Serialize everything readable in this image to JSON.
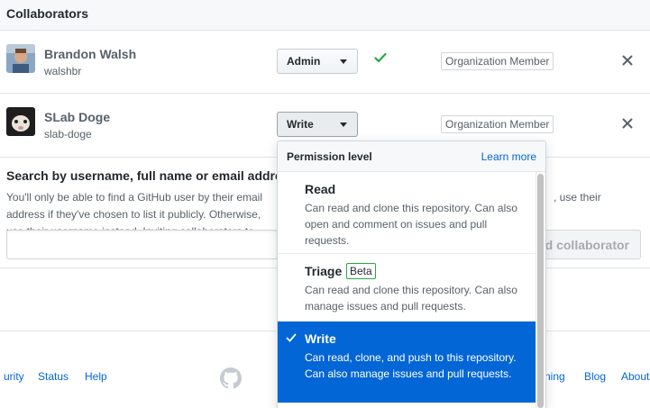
{
  "header": {
    "title": "Collaborators"
  },
  "collaborators": [
    {
      "name": "Brandon Walsh",
      "login": "walshbr",
      "permission": "Admin",
      "badge": "Organization Member"
    },
    {
      "name": "SLab Doge",
      "login": "slab-doge",
      "permission": "Write",
      "badge": "Organization Member"
    }
  ],
  "search": {
    "heading": "Search by username, full name or email address",
    "note_left": "You'll only be able to find a GitHub user by their email address if they've chosen to list it publicly. Otherwise, use their username instead. Inviting collaborators to public repositories",
    "note_right": ", use their",
    "input_value": "",
    "add_button": "Add collaborator"
  },
  "footer": {
    "links": [
      "urity",
      "Status",
      "Help",
      "ning",
      "Blog",
      "About"
    ]
  },
  "menu": {
    "title": "Permission level",
    "learn_more": "Learn more",
    "items": [
      {
        "title": "Read",
        "description": "Can read and clone this repository. Can also open and comment on issues and pull requests.",
        "selected": false
      },
      {
        "title": "Triage",
        "badge": "Beta",
        "description": "Can read and clone this repository. Can also manage issues and pull requests.",
        "selected": false
      },
      {
        "title": "Write",
        "description": "Can read, clone, and push to this repository. Can also manage issues and pull requests.",
        "selected": true
      }
    ]
  },
  "colors": {
    "accent": "#0366d6",
    "success": "#28a745",
    "text": "#24292e",
    "muted": "#586069"
  }
}
